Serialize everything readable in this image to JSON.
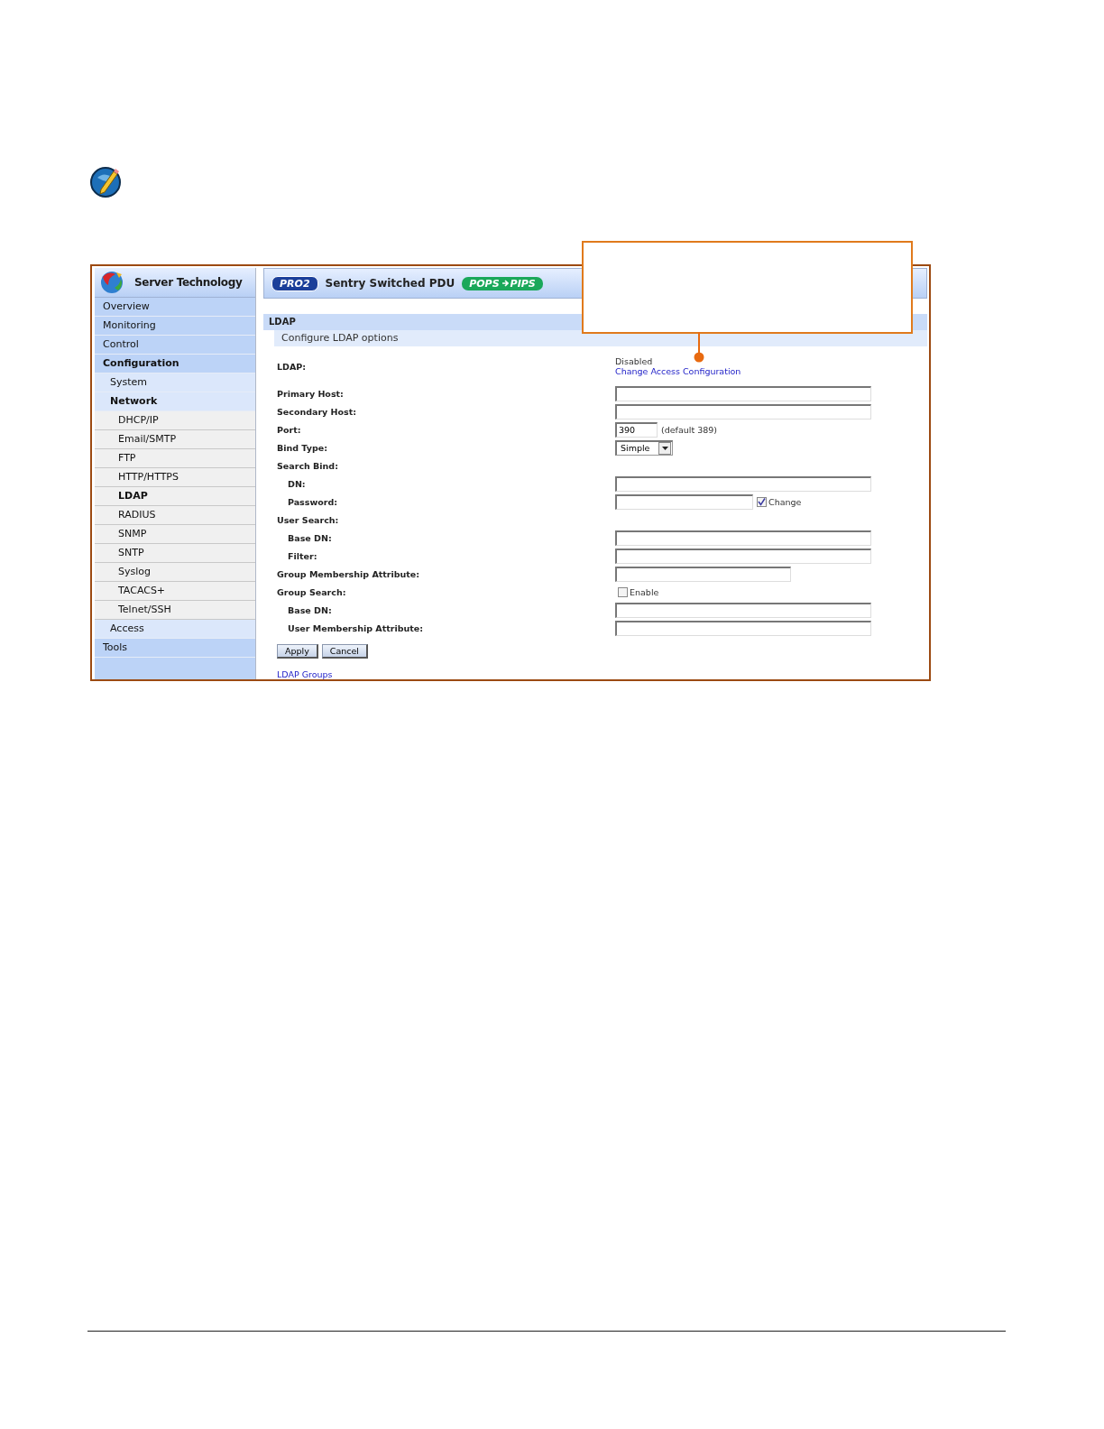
{
  "header": {
    "brand": "Server Technology",
    "badge": "PRO2",
    "product": "Sentry Switched PDU",
    "tag": [
      "POPS",
      "PIPS"
    ]
  },
  "sidebar": {
    "items": [
      {
        "label": "Overview",
        "selected": false
      },
      {
        "label": "Monitoring",
        "selected": false
      },
      {
        "label": "Control",
        "selected": false
      },
      {
        "label": "Configuration",
        "selected": true,
        "children": [
          {
            "label": "System",
            "selected": false
          },
          {
            "label": "Network",
            "selected": true,
            "children": [
              {
                "label": "DHCP/IP",
                "selected": false
              },
              {
                "label": "Email/SMTP",
                "selected": false
              },
              {
                "label": "FTP",
                "selected": false
              },
              {
                "label": "HTTP/HTTPS",
                "selected": false
              },
              {
                "label": "LDAP",
                "selected": true
              },
              {
                "label": "RADIUS",
                "selected": false
              },
              {
                "label": "SNMP",
                "selected": false
              },
              {
                "label": "SNTP",
                "selected": false
              },
              {
                "label": "Syslog",
                "selected": false
              },
              {
                "label": "TACACS+",
                "selected": false
              },
              {
                "label": "Telnet/SSH",
                "selected": false
              }
            ]
          },
          {
            "label": "Access",
            "selected": false
          }
        ]
      },
      {
        "label": "Tools",
        "selected": false
      }
    ]
  },
  "section": {
    "title": "LDAP",
    "subtitle": "Configure LDAP options"
  },
  "form": {
    "rows": [
      {
        "label": "LDAP:",
        "control": {
          "kind": "status",
          "value": "Disabled",
          "link": "Change Access Configuration"
        }
      },
      {
        "label": "Primary Host:",
        "control": {
          "kind": "text-wide"
        }
      },
      {
        "label": "Secondary Host:",
        "control": {
          "kind": "text-wide"
        }
      },
      {
        "label": "Port:",
        "control": {
          "kind": "text-short",
          "value": "390",
          "note": "(default 389)"
        }
      },
      {
        "label": "Bind Type:",
        "control": {
          "kind": "select",
          "value": "Simple"
        }
      },
      {
        "label": "Search Bind:",
        "control": {
          "kind": "none"
        },
        "children": [
          {
            "label": "DN:",
            "control": {
              "kind": "text-wide"
            }
          },
          {
            "label": "Password:",
            "control": {
              "kind": "text-medium",
              "checkbox": {
                "label": "Change",
                "checked": true
              }
            }
          }
        ]
      },
      {
        "label": "User Search:",
        "control": {
          "kind": "none"
        },
        "children": [
          {
            "label": "Base DN:",
            "control": {
              "kind": "text-wide"
            }
          },
          {
            "label": "Filter:",
            "control": {
              "kind": "text-wide"
            }
          }
        ]
      },
      {
        "label": "Group Membership Attribute:",
        "control": {
          "kind": "text-long"
        }
      },
      {
        "label": "Group Search:",
        "control": {
          "kind": "checkbox",
          "checkbox": {
            "label": "Enable",
            "checked": false
          }
        },
        "children": [
          {
            "label": "Base DN:",
            "control": {
              "kind": "text-wide"
            }
          },
          {
            "label": "User Membership Attribute:",
            "control": {
              "kind": "text-wide"
            }
          }
        ]
      }
    ],
    "buttons": [
      "Apply",
      "Cancel"
    ],
    "link": "LDAP Groups"
  }
}
